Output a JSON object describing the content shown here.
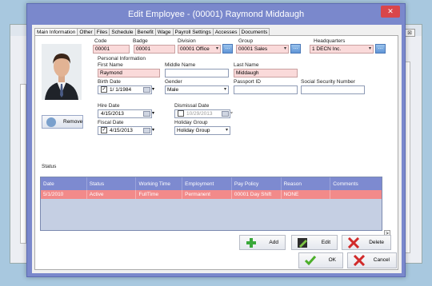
{
  "background_window": {
    "close_label": "⊠"
  },
  "dialog": {
    "title": "Edit Employee - (00001) Raymond Middaugh",
    "close_label": "✕"
  },
  "tabs": [
    "Main Information",
    "Other",
    "Files",
    "Schedule",
    "Benefit",
    "Wage",
    "Payroll Settings",
    "Accesses",
    "Documents"
  ],
  "labels": {
    "code": "Code",
    "badge": "Badge",
    "division": "Division",
    "group": "Group",
    "headquarters": "Headquarters",
    "personal_info": "Personal Information",
    "first_name": "First Name",
    "middle_name": "Middle Name",
    "last_name": "Last Name",
    "birth_date": "Birth Date",
    "gender": "Gender",
    "passport_id": "Passport ID",
    "ssn": "Social Security Number",
    "hire_date": "Hire Date",
    "dismissal_date": "Dismissal Date",
    "fiscal_date": "Fiscal Date",
    "holiday_group": "Holiday Group",
    "status": "Status"
  },
  "fields": {
    "code": "00001",
    "badge": "00001",
    "division": "00001  Office",
    "group": "00001  Sales",
    "headquarters": "1  DECN Inc.",
    "first_name": "Raymond",
    "middle_name": "",
    "last_name": "Middaugh",
    "birth_date": "1/  1/1984",
    "gender": "Male",
    "passport_id": "",
    "ssn": "",
    "hire_date": "4/15/2013",
    "dismissal_date": "10/29/2013",
    "fiscal_date": "4/15/2013",
    "holiday_group": "Holiday Group"
  },
  "buttons": {
    "remove": "Remove",
    "dots": "...",
    "add": "Add",
    "edit": "Edit",
    "delete": "Delete",
    "ok": "OK",
    "cancel": "Cancel"
  },
  "status_table": {
    "columns": [
      "Date",
      "Status",
      "Working Time",
      "Employment",
      "Pay Policy",
      "Reason",
      "Comments"
    ],
    "rows": [
      [
        "5/1/2010",
        "Active",
        "FullTime",
        "Permanent",
        "00001  Day Shift",
        "NONE",
        ""
      ]
    ]
  },
  "colors": {
    "title_bar": "#7a88cc",
    "grid_header": "#7d8ad0",
    "selected_row": "#f28a8a",
    "required_field": "#fadada"
  }
}
